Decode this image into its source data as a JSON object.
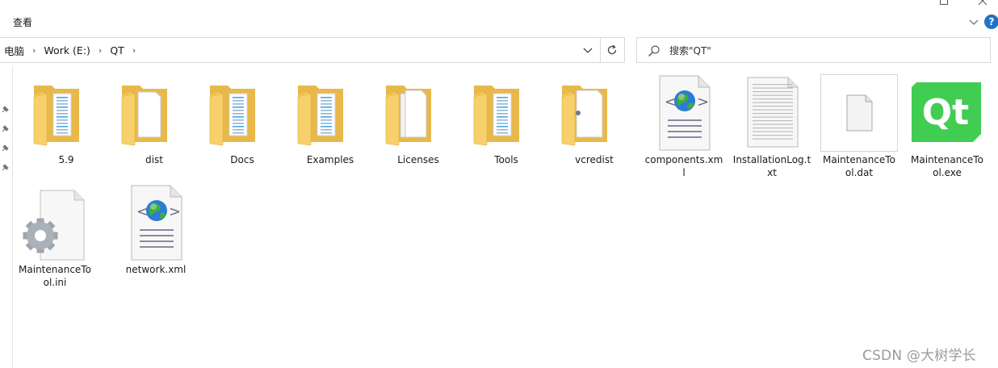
{
  "ribbon": {
    "tab_label": "查看"
  },
  "address_bar": {
    "crumbs": [
      "电脑",
      "Work (E:)",
      "QT"
    ]
  },
  "search": {
    "placeholder": "搜索\"QT\""
  },
  "items": [
    {
      "name": "5.9",
      "type": "folder",
      "label_lines": [
        "5.9"
      ]
    },
    {
      "name": "dist",
      "type": "folder",
      "label_lines": [
        "dist"
      ]
    },
    {
      "name": "Docs",
      "type": "folder",
      "label_lines": [
        "Docs"
      ]
    },
    {
      "name": "Examples",
      "type": "folder",
      "label_lines": [
        "Examples"
      ]
    },
    {
      "name": "Licenses",
      "type": "folder",
      "label_lines": [
        "Licenses"
      ]
    },
    {
      "name": "Tools",
      "type": "folder",
      "label_lines": [
        "Tools"
      ]
    },
    {
      "name": "vcredist",
      "type": "folder",
      "label_lines": [
        "vcredist"
      ]
    },
    {
      "name": "components.xml",
      "type": "xml-file",
      "label_lines": [
        "components.xm",
        "l"
      ]
    },
    {
      "name": "InstallationLog.txt",
      "type": "text-file",
      "label_lines": [
        "InstallationLog.t",
        "xt"
      ]
    },
    {
      "name": "MaintenanceTool.dat",
      "type": "blank-file",
      "label_lines": [
        "MaintenanceTo",
        "ol.dat"
      ]
    },
    {
      "name": "MaintenanceTool.exe",
      "type": "qt-exe",
      "label_lines": [
        "MaintenanceTo",
        "ol.exe"
      ]
    },
    {
      "name": "MaintenanceTool.ini",
      "type": "ini-file",
      "label_lines": [
        "MaintenanceTo",
        "ol.ini"
      ]
    },
    {
      "name": "network.xml",
      "type": "xml-file",
      "label_lines": [
        "network.xml"
      ]
    }
  ],
  "qt_logo_text": "Qt",
  "watermark": "CSDN @大树学长",
  "colors": {
    "folder_back": "#e8b84a",
    "folder_front": "#f8d775",
    "qt_green": "#41cd52",
    "help_blue": "#1e73c9"
  }
}
